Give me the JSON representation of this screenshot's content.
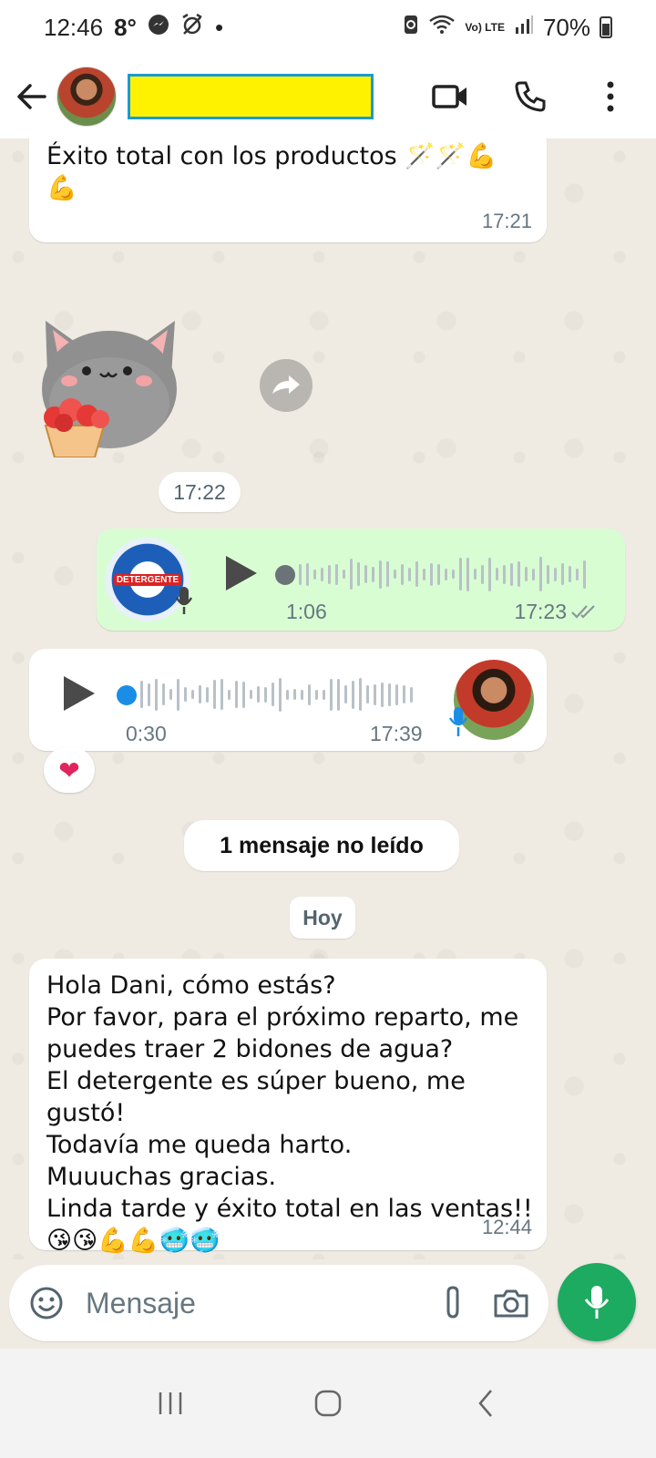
{
  "status_bar": {
    "time": "12:46",
    "temperature": "8°",
    "dot": "•",
    "network": "Vo) LTE",
    "battery": "70%"
  },
  "header": {
    "contact_name": "",
    "icons": [
      "back-arrow-icon",
      "video-call-icon",
      "phone-call-icon",
      "more-options-icon"
    ]
  },
  "messages": {
    "m1": {
      "text": "Éxito total con los productos 🪄🪄💪\n💪",
      "time": "17:21"
    },
    "sticker": {
      "time": "17:22"
    },
    "voice_out": {
      "duration": "1:06",
      "time": "17:23",
      "doc_label": "DETERGENTE"
    },
    "voice_in": {
      "duration": "0:30",
      "time": "17:39",
      "reaction": "❤"
    },
    "unread": "1 mensaje no leído",
    "day": "Hoy",
    "m2": {
      "text": "Hola Dani, cómo estás?\nPor favor,  para el próximo reparto,  me\npuedes traer 2 bidones de agua?\nEl detergente es súper bueno, me gustó!\nTodavía me queda harto.\nMuuuchas gracias.\nLinda tarde y éxito total en las ventas!!\n😘😘💪💪🥶🥶",
      "time": "12:44"
    }
  },
  "composer": {
    "placeholder": "Mensaje"
  },
  "colors": {
    "incoming": "#ffffff",
    "outgoing": "#d9fdd3",
    "accent_green": "#1daa61",
    "voice_dot_blue": "#1a8ee6",
    "name_redaction_yellow": "#fff200"
  }
}
